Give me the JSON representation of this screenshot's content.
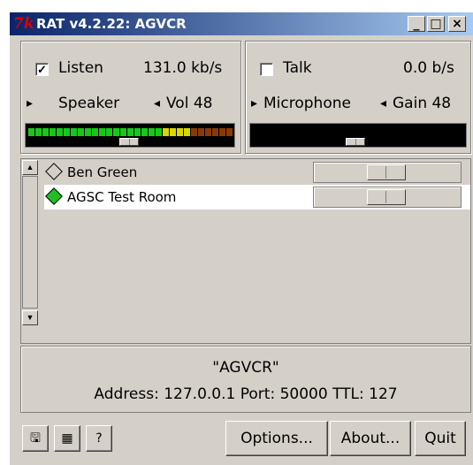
{
  "window": {
    "icon_glyph": "7k",
    "title": "RAT v4.2.22: AGVCR",
    "minimize_glyph": "_",
    "maximize_glyph": "□",
    "close_glyph": "×"
  },
  "listen_panel": {
    "checked": true,
    "check_glyph": "✓",
    "label": "Listen",
    "rate": "131.0 kb/s",
    "device_arrow": "▸",
    "device": "Speaker",
    "level_arrow": "◂",
    "level_label": "Vol 48",
    "slider_level": 48
  },
  "talk_panel": {
    "checked": false,
    "check_glyph": "",
    "label": "Talk",
    "rate": "0.0 b/s",
    "device_arrow": "▸",
    "device": "Microphone",
    "level_arrow": "◂",
    "level_label": "Gain 48",
    "slider_level": 48
  },
  "participants": [
    {
      "name": "Ben Green",
      "indicator": "inactive"
    },
    {
      "name": "AGSC Test Room",
      "indicator": "active",
      "selected": true
    }
  ],
  "scrollbar": {
    "up_glyph": "▲",
    "down_glyph": "▼"
  },
  "session": {
    "name": "\"AGVCR\"",
    "details": "Address: 127.0.0.1 Port: 50000 TTL: 127"
  },
  "toolbar": {
    "save_icon": "save-icon",
    "grid_icon": "grid-icon",
    "help_icon": "help-icon",
    "save_glyph": "🖫",
    "grid_glyph": "▦",
    "help_glyph": "?",
    "options_label": "Options...",
    "about_label": "About...",
    "quit_label": "Quit"
  },
  "colors": {
    "meter_green": "#18c818",
    "meter_yellow": "#d8d800",
    "meter_dark": "#8a3a00",
    "active_indicator": "#20c020"
  }
}
